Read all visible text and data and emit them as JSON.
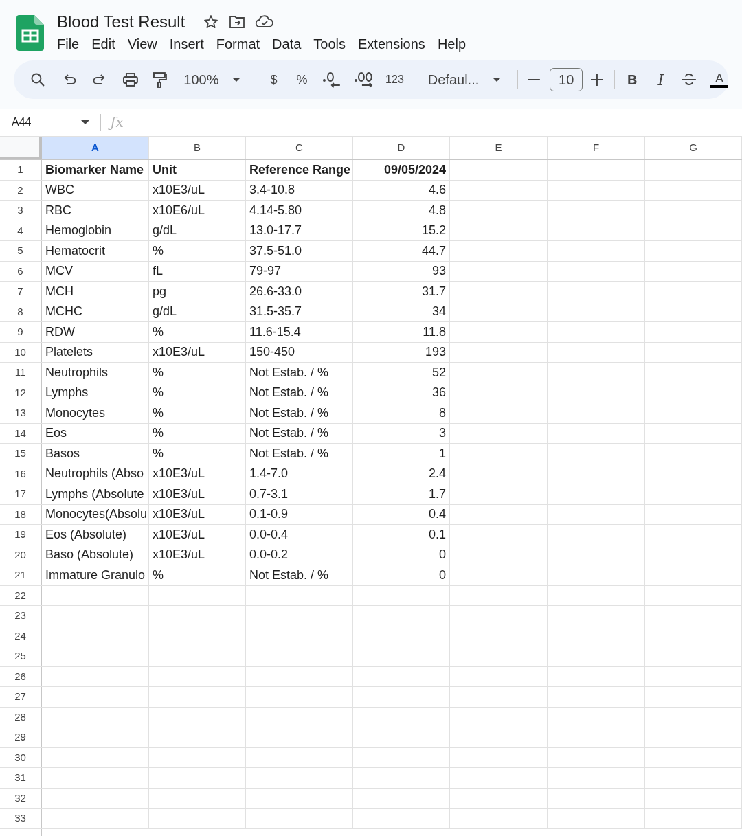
{
  "document": {
    "title": "Blood Test Result"
  },
  "menu": [
    "File",
    "Edit",
    "View",
    "Insert",
    "Format",
    "Data",
    "Tools",
    "Extensions",
    "Help"
  ],
  "toolbar": {
    "zoom": "100%",
    "currency": "$",
    "percent": "%",
    "more_formats": "123",
    "font": "Defaul...",
    "font_size": "10",
    "bold": "B",
    "italic": "I",
    "text_color": "A"
  },
  "formula_bar": {
    "name_box": "A44",
    "function_sign": "ƒx"
  },
  "columns": [
    {
      "label": "A",
      "selected": true,
      "kind": "text"
    },
    {
      "label": "B",
      "selected": false,
      "kind": "text"
    },
    {
      "label": "C",
      "selected": false,
      "kind": "text"
    },
    {
      "label": "D",
      "selected": false,
      "kind": "number"
    },
    {
      "label": "E",
      "selected": false,
      "kind": "text"
    },
    {
      "label": "F",
      "selected": false,
      "kind": "text"
    },
    {
      "label": "G",
      "selected": false,
      "kind": "text"
    }
  ],
  "rows": [
    {
      "number": "1",
      "bold": true,
      "cells": [
        "Biomarker Name",
        "Unit",
        "Reference Range",
        "09/05/2024"
      ]
    },
    {
      "number": "2",
      "bold": false,
      "cells": [
        "WBC",
        "x10E3/uL",
        "3.4-10.8",
        "4.6"
      ]
    },
    {
      "number": "3",
      "bold": false,
      "cells": [
        "RBC",
        "x10E6/uL",
        "4.14-5.80",
        "4.8"
      ]
    },
    {
      "number": "4",
      "bold": false,
      "cells": [
        "Hemoglobin",
        "g/dL",
        "13.0-17.7",
        "15.2"
      ]
    },
    {
      "number": "5",
      "bold": false,
      "cells": [
        "Hematocrit",
        "%",
        "37.5-51.0",
        "44.7"
      ]
    },
    {
      "number": "6",
      "bold": false,
      "cells": [
        "MCV",
        "fL",
        "79-97",
        "93"
      ]
    },
    {
      "number": "7",
      "bold": false,
      "cells": [
        "MCH",
        "pg",
        "26.6-33.0",
        "31.7"
      ]
    },
    {
      "number": "8",
      "bold": false,
      "cells": [
        "MCHC",
        "g/dL",
        "31.5-35.7",
        "34"
      ]
    },
    {
      "number": "9",
      "bold": false,
      "cells": [
        "RDW",
        "%",
        "11.6-15.4",
        "11.8"
      ]
    },
    {
      "number": "10",
      "bold": false,
      "cells": [
        "Platelets",
        "x10E3/uL",
        "150-450",
        "193"
      ]
    },
    {
      "number": "11",
      "bold": false,
      "cells": [
        "Neutrophils",
        "%",
        "Not Estab. / %",
        "52"
      ]
    },
    {
      "number": "12",
      "bold": false,
      "cells": [
        "Lymphs",
        "%",
        "Not Estab. / %",
        "36"
      ]
    },
    {
      "number": "13",
      "bold": false,
      "cells": [
        "Monocytes",
        "%",
        "Not Estab. / %",
        "8"
      ]
    },
    {
      "number": "14",
      "bold": false,
      "cells": [
        "Eos",
        "%",
        "Not Estab. / %",
        "3"
      ]
    },
    {
      "number": "15",
      "bold": false,
      "cells": [
        "Basos",
        "%",
        "Not Estab. / %",
        "1"
      ]
    },
    {
      "number": "16",
      "bold": false,
      "cells": [
        "Neutrophils (Abso",
        "x10E3/uL",
        "1.4-7.0",
        "2.4"
      ]
    },
    {
      "number": "17",
      "bold": false,
      "cells": [
        "Lymphs (Absolute",
        "x10E3/uL",
        "0.7-3.1",
        "1.7"
      ]
    },
    {
      "number": "18",
      "bold": false,
      "cells": [
        "Monocytes(Absolu",
        "x10E3/uL",
        "0.1-0.9",
        "0.4"
      ]
    },
    {
      "number": "19",
      "bold": false,
      "cells": [
        "Eos (Absolute)",
        "x10E3/uL",
        "0.0-0.4",
        "0.1"
      ]
    },
    {
      "number": "20",
      "bold": false,
      "cells": [
        "Baso (Absolute)",
        "x10E3/uL",
        "0.0-0.2",
        "0"
      ]
    },
    {
      "number": "21",
      "bold": false,
      "cells": [
        "Immature Granulo",
        "%",
        "Not Estab. / %",
        "0"
      ]
    },
    {
      "number": "22"
    },
    {
      "number": "23"
    },
    {
      "number": "24"
    },
    {
      "number": "25"
    },
    {
      "number": "26"
    },
    {
      "number": "27"
    },
    {
      "number": "28"
    },
    {
      "number": "29"
    },
    {
      "number": "30"
    },
    {
      "number": "31"
    },
    {
      "number": "32"
    },
    {
      "number": "33"
    }
  ]
}
